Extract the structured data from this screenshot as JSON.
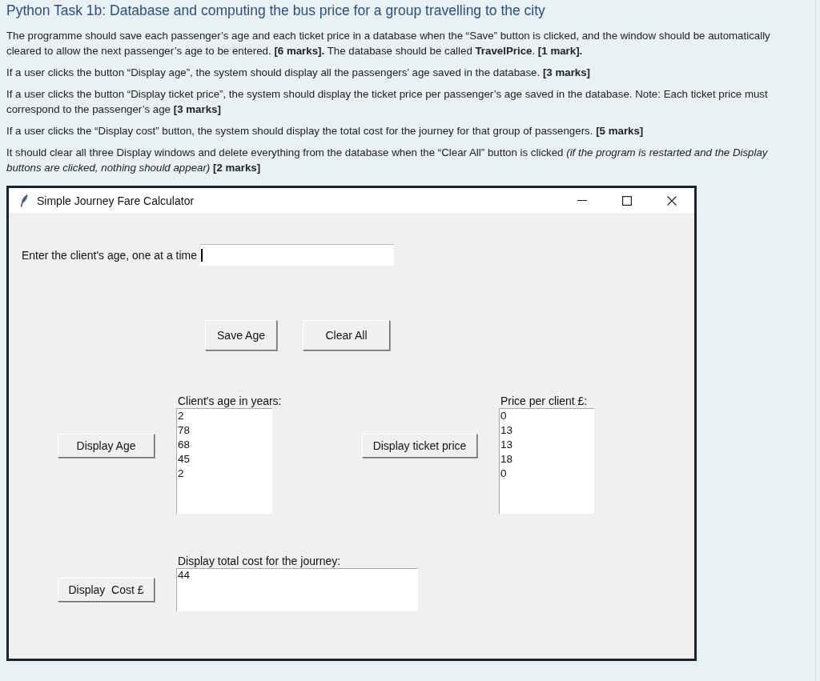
{
  "heading": "Python Task 1b: Database and computing the bus price for a group travelling to the city",
  "paragraphs": [
    "The programme should save each passenger’s age and each ticket price in a database when the “Save” button is clicked, and the window should be automatically cleared to allow the next passenger’s age to be entered. **[6 marks].** The database should be called **TravelPrice**. **[1 mark].**",
    "If a user clicks the button “Display age”, the system should display all the passengers’ age saved in the database. **[3 marks]**",
    "If a user clicks the button “Display ticket price”, the system should display the ticket price per passenger’s age saved in the database. Note: Each ticket price must correspond to the passenger’s age **[3 marks]**",
    "If a user clicks the “Display cost” button, the system should display the total cost for the journey for that group of passengers. **[5 marks]**",
    "It should clear all three Display windows and delete everything from the database when the “Clear All” button is clicked *(if the program is restarted and the Display buttons are clicked, nothing should appear)* **[2 marks]**"
  ],
  "window": {
    "title": "Simple Journey Fare Calculator",
    "age_entry": {
      "label": "Enter the client's age, one at a time",
      "focused": true
    },
    "buttons": [
      "Save Age",
      "Clear All"
    ],
    "age_list": {
      "button": "Display Age",
      "label": "Client's age in years:",
      "items": [
        "2",
        "78",
        "68",
        "45",
        "2"
      ]
    },
    "price_list": {
      "button": "Display ticket price",
      "label": "Price per client £:",
      "items": [
        "0",
        "13",
        "13",
        "18",
        "0"
      ]
    },
    "cost": {
      "button": "Display  Cost £",
      "label": "Display total cost for the journey:",
      "value": "44"
    }
  }
}
